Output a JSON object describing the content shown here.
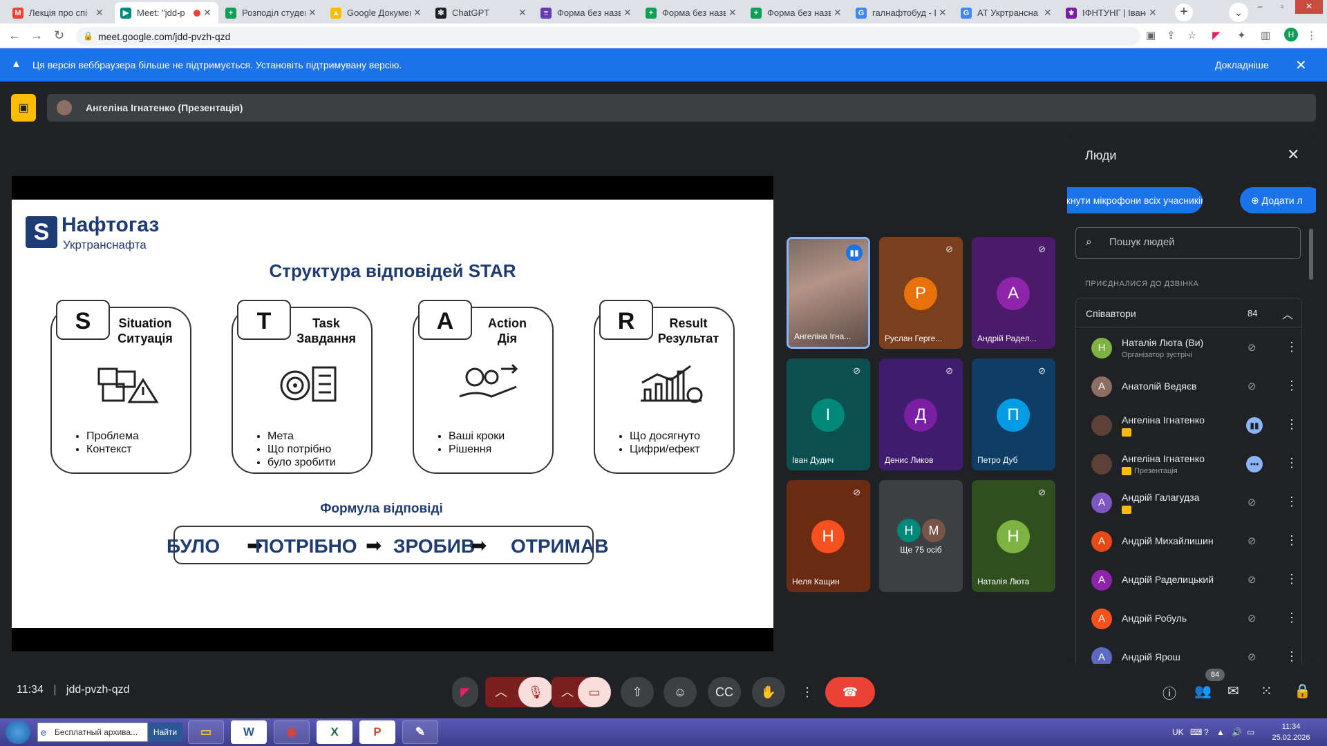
{
  "tabs": [
    {
      "title": "Лекція про спі",
      "favicon": "gmail-icon",
      "color": "#ea4335",
      "glyph": "M"
    },
    {
      "title": "Meet: \"jdd-p",
      "favicon": "meet-icon",
      "color": "#00897b",
      "glyph": "▶"
    },
    {
      "title": "Розподіл студен",
      "favicon": "sheets-icon",
      "color": "#0f9d58",
      "glyph": "+"
    },
    {
      "title": "Google Докумен",
      "favicon": "drive-icon",
      "color": "#fbbc04",
      "glyph": "▲"
    },
    {
      "title": "ChatGPT",
      "favicon": "chatgpt-icon",
      "color": "#202124",
      "glyph": "✻"
    },
    {
      "title": "Форма без назв",
      "favicon": "forms-icon",
      "color": "#673ab7",
      "glyph": "≡"
    },
    {
      "title": "Форма без назв",
      "favicon": "sheets-icon",
      "color": "#0f9d58",
      "glyph": "+"
    },
    {
      "title": "Форма без назв",
      "favicon": "sheets-icon",
      "color": "#0f9d58",
      "glyph": "+"
    },
    {
      "title": "галнафтобуд - П",
      "favicon": "google-icon",
      "color": "#4285f4",
      "glyph": "G"
    },
    {
      "title": "АТ Укртрансна",
      "favicon": "google-icon",
      "color": "#4285f4",
      "glyph": "G"
    },
    {
      "title": "ІФНТУНГ | Івано",
      "favicon": "university-icon",
      "color": "#7b1fa2",
      "glyph": "⚜"
    }
  ],
  "address": {
    "url": "meet.google.com/jdd-pvzh-qzd"
  },
  "infobar": {
    "message": "Ця версія веббраузера більше не підтримується. Установіть підтримувану версію.",
    "more": "Докладніше"
  },
  "presenter": {
    "name": "Ангеліна Ігнатенко (Презентація)"
  },
  "slide": {
    "brand": "Нафтогаз",
    "brand_sub": "Укртранснафта",
    "logo_mark": "S",
    "title": "Структура відповідей STAR",
    "cards": [
      {
        "letter": "S",
        "en": "Situation",
        "ua": "Ситуація",
        "bullets": [
          "Проблема",
          "Контекст"
        ],
        "icon": "puzzle-warning-icon"
      },
      {
        "letter": "T",
        "en": "Task",
        "ua": "Завдання",
        "bullets": [
          "Мета",
          "Що потрібно",
          "було зробити"
        ],
        "icon": "target-checklist-icon"
      },
      {
        "letter": "A",
        "en": "Action",
        "ua": "Дія",
        "bullets": [
          "Ваші кроки",
          "Рішення"
        ],
        "icon": "gears-hand-icon"
      },
      {
        "letter": "R",
        "en": "Result",
        "ua": "Результат",
        "bullets": [
          "Що досягнуто",
          "Цифри/ефект"
        ],
        "icon": "growth-chart-icon"
      }
    ],
    "formula_title": "Формула відповіді",
    "formula": [
      "БУЛО",
      "ПОТРІБНО",
      "ЗРОБИВ",
      "ОТРИМАВ"
    ],
    "arrow": "➡"
  },
  "tiles": [
    {
      "label": "Ангеліна Ігна...",
      "type": "video"
    },
    {
      "label": "Руслан Герге...",
      "initial": "Р",
      "bg": "#7a3f1d",
      "circle": "#e8710a"
    },
    {
      "label": "Андрій Радел...",
      "initial": "А",
      "bg": "#4a1b6b",
      "circle": "#8e24aa"
    },
    {
      "label": "Іван Дудич",
      "initial": "І",
      "bg": "#0b4f4f",
      "circle": "#00897b"
    },
    {
      "label": "Денис Ликов",
      "initial": "Д",
      "bg": "#3f1c6e",
      "circle": "#7b1fa2"
    },
    {
      "label": "Петро Дуб",
      "initial": "П",
      "bg": "#0e3e66",
      "circle": "#039be5"
    },
    {
      "label": "Неля Кащин",
      "initial": "Н",
      "bg": "#6b2a12",
      "circle": "#f4511e"
    },
    {
      "label": "Ще 75 осіб",
      "initial": "Н",
      "initial2": "М",
      "bg": "#3c4043",
      "circle": "#00897b",
      "circle2": "#795548"
    },
    {
      "label": "Наталія Люта",
      "initial": "Н",
      "bg": "#2f4f1f",
      "circle": "#7cb342"
    }
  ],
  "people": {
    "title": "Люди",
    "mute_all": "Вимкнути мікрофони всіх учасників",
    "add": "Додати л",
    "search_placeholder": "Пошук людей",
    "section": "ПРИЄДНАЛИСЯ ДО ДЗВІНКА",
    "group": "Співавтори",
    "count": "84",
    "rows": [
      {
        "name": "Наталія Люта (Ви)",
        "sub": "Організатор зустрічі",
        "initial": "Н",
        "color": "#7cb342",
        "status": "muted"
      },
      {
        "name": "Анатолій Ведяєв",
        "initial": "А",
        "color": "#8d6e63",
        "status": "muted"
      },
      {
        "name": "Ангеліна Ігнатенко",
        "badge": true,
        "initial": "",
        "color": "#5d4037",
        "status": "speaking"
      },
      {
        "name": "Ангеліна Ігнатенко",
        "sub": "Презентація",
        "badge": true,
        "initial": "",
        "color": "#5d4037",
        "status": "presenting"
      },
      {
        "name": "Андрій Галагудза",
        "badge": true,
        "initial": "А",
        "color": "#7e57c2",
        "status": "muted"
      },
      {
        "name": "Андрій Михайлишин",
        "initial": "А",
        "color": "#e64a19",
        "status": "muted"
      },
      {
        "name": "Андрій Раделицький",
        "initial": "А",
        "color": "#8e24aa",
        "status": "muted"
      },
      {
        "name": "Андрій Робуль",
        "initial": "А",
        "color": "#f4511e",
        "status": "muted"
      },
      {
        "name": "Андрій Ярош",
        "initial": "А",
        "color": "#5c6bc0",
        "status": "muted"
      }
    ]
  },
  "controls": {
    "time": "11:34",
    "separator": "|",
    "meeting_code": "jdd-pvzh-qzd",
    "people_count": "84"
  },
  "taskbar": {
    "search_value": "Бесплатный архива...",
    "find": "Найти",
    "lang": "UK",
    "time": "11:34",
    "date": "25.02.2026"
  }
}
